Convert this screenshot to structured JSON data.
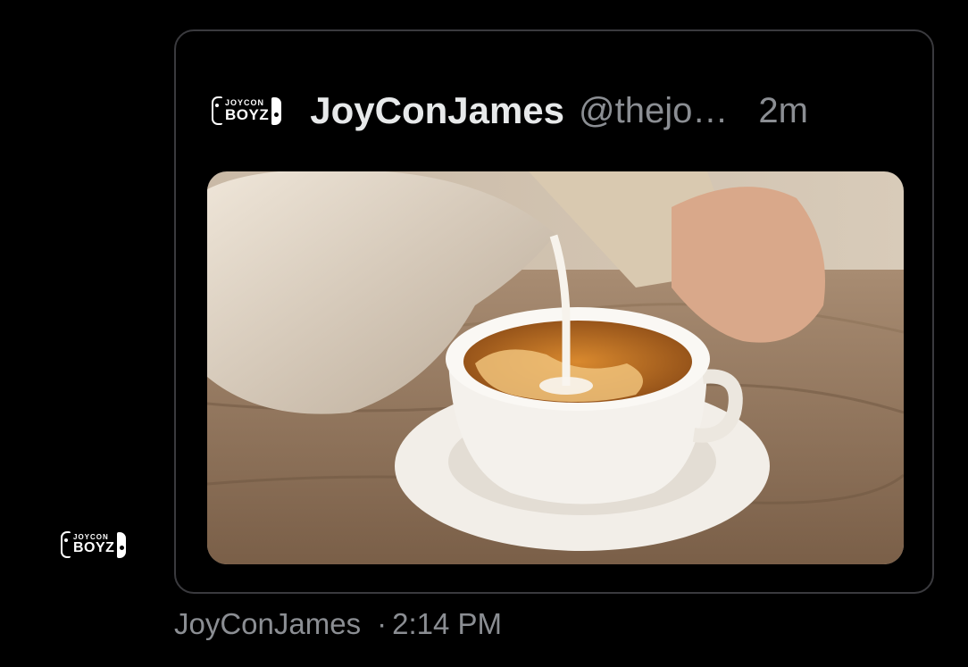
{
  "quoted_tweet": {
    "logo_text_top": "JOYCON",
    "logo_text_bottom": "BOYZ",
    "display_name": "JoyConJames",
    "handle": "@thejo…",
    "time_ago": "2m",
    "media_icon": "image-tea-with-milk"
  },
  "avatar": {
    "logo_text_top": "JOYCON",
    "logo_text_bottom": "BOYZ"
  },
  "footer": {
    "author": "JoyConJames",
    "separator": "·",
    "timestamp": "2:14 PM"
  },
  "colors": {
    "background": "#000000",
    "border": "#3a3a3e",
    "primary_text": "#e7e9ea",
    "secondary_text": "#8b8e93"
  }
}
